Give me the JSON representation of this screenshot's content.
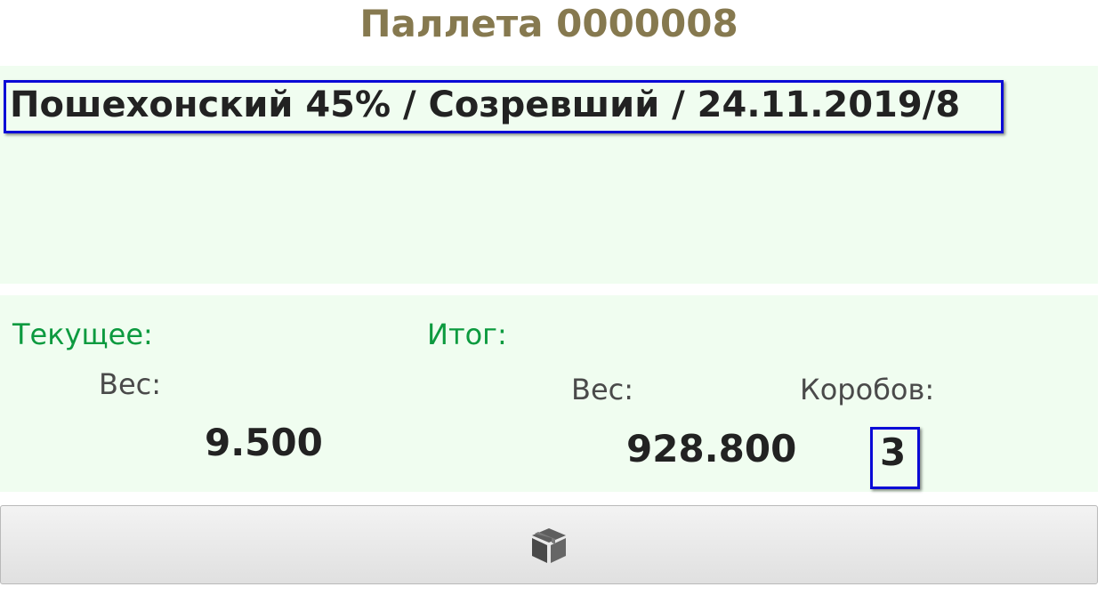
{
  "header": {
    "title": "Паллета 0000008"
  },
  "product": {
    "name": "Пошехонский 45% / Созревший / 24.11.2019/8"
  },
  "current": {
    "label": "Текущее:",
    "weight_label": "Вес:",
    "weight_value": "9.500"
  },
  "total": {
    "label": "Итог:",
    "weight_label": "Вес:",
    "weight_value": "928.800",
    "boxes_label": "Коробов:",
    "boxes_value": "3"
  },
  "action_button": {
    "icon": "cube-box-icon"
  },
  "colors": {
    "title": "#86794f",
    "panel_bg": "#f0fdf0",
    "accent_green": "#0c9a3f",
    "focus_border": "#0a0ad6"
  }
}
